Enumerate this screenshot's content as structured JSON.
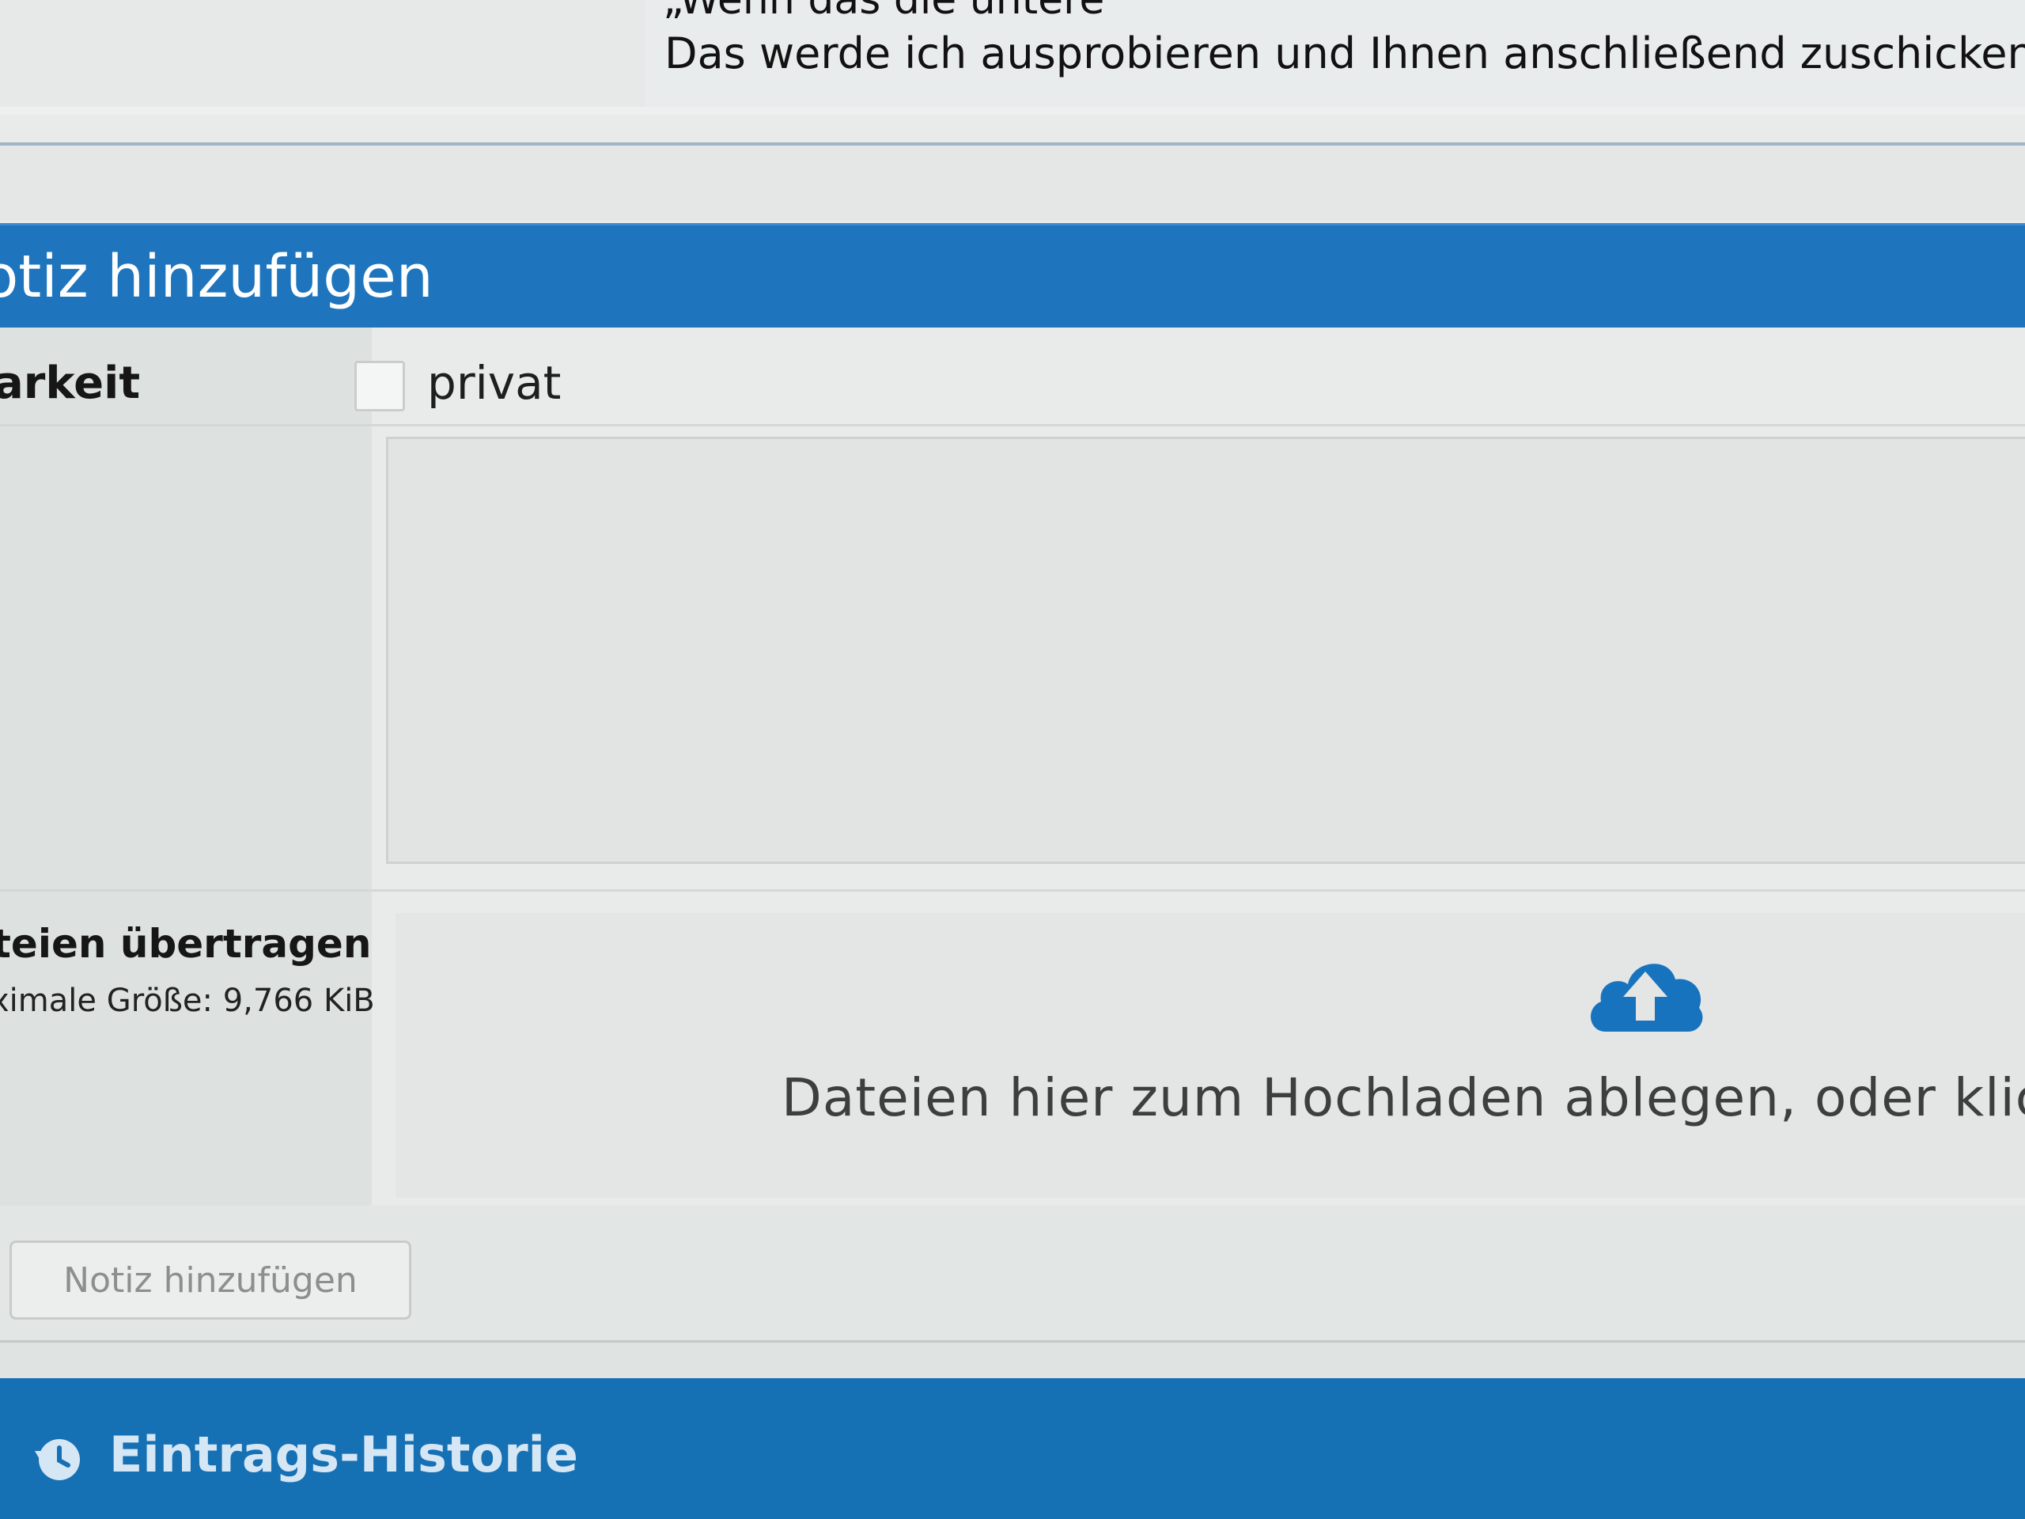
{
  "top_note": {
    "cutoff_line": "„Wenn das die untere",
    "text": "Das werde ich ausprobieren und Ihnen anschließend zuschicken."
  },
  "add_note": {
    "title": "otiz hinzufügen",
    "visibility_label": "arkeit",
    "private_checkbox_label": "privat",
    "private_checked": false,
    "note_text_value": "",
    "upload_label": "teien übertragen",
    "max_size_label": "ximale Größe: 9,766 KiB",
    "drop_zone_text": "Dateien hier zum Hochladen ablegen, oder klick",
    "submit_label": "Notiz hinzufügen"
  },
  "history": {
    "title": "Eintrags-Historie"
  },
  "colors": {
    "header_blue": "#1e75bd",
    "history_blue": "#1670b4",
    "cloud_icon_blue": "#1873bf"
  },
  "icons": {
    "upload": "cloud-upload-icon",
    "history": "history-icon"
  }
}
